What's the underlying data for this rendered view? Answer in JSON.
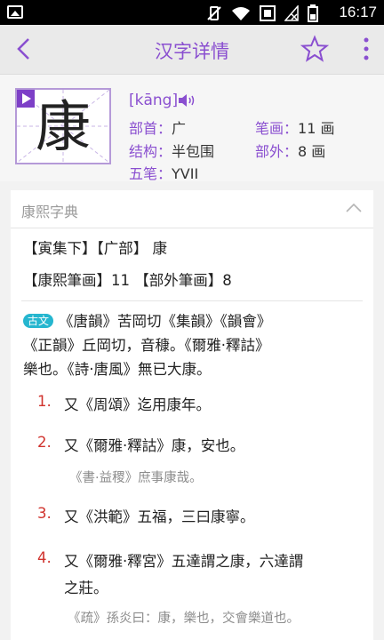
{
  "status_bar": {
    "time": "16:17"
  },
  "app_bar": {
    "title": "汉字详情"
  },
  "header": {
    "character": "康",
    "pinyin": "[kāng]",
    "radical_label": "部首：",
    "radical_value": "广",
    "strokes_label": "笔画：",
    "strokes_value": "11 画",
    "structure_label": "结构：",
    "structure_value": "半包围",
    "extra_strokes_label": "部外：",
    "extra_strokes_value": "8 画",
    "wubi_label": "五笔：",
    "wubi_value": "YVII"
  },
  "kangxi": {
    "section_title": "康熙字典",
    "line1": "【寅集下】【广部】 康",
    "line2": "【康熙筆画】11 【部外筆画】8",
    "tag": "古文",
    "para1_a": "《唐韻》苦岡切《集韻》《韻會》",
    "para1_b": "《正韻》丘岡切，音穅。《爾雅·釋詁》",
    "para1_c": "樂也。《詩·唐風》無已大康。",
    "items": [
      {
        "num": "1.",
        "text": "又《周頌》迄用康年。"
      },
      {
        "num": "2.",
        "text": "又《爾雅·釋詁》康，安也。",
        "example": "《書·益稷》庶事康哉。"
      },
      {
        "num": "3.",
        "text": "又《洪範》五福，三曰康寧。"
      },
      {
        "num": "4.",
        "text": "又《爾雅·釋宮》五達謂之康，六達謂",
        "text2": "之莊。",
        "example": "《疏》孫炎曰：康，樂也，交會樂道也。"
      }
    ]
  },
  "colors": {
    "accent": "#8a4fd0",
    "number": "#d0322d",
    "tag_bg": "#25b6cf"
  }
}
